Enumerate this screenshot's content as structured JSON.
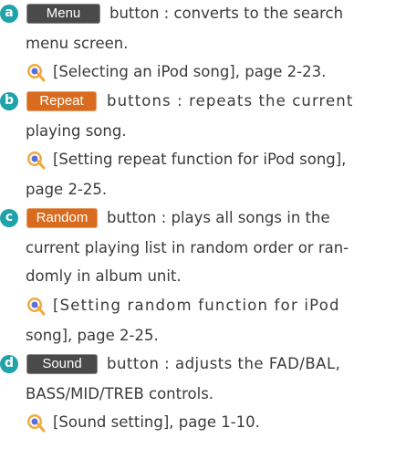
{
  "items": [
    {
      "bullet": "a",
      "button_label": "Menu",
      "desc_first": "button : converts to the search",
      "desc_rest": [
        "menu screen."
      ],
      "ref": [
        "[Selecting an iPod song], page 2-23."
      ]
    },
    {
      "bullet": "b",
      "button_label": "Repeat",
      "desc_first": "buttons : repeats the current",
      "desc_rest": [
        "playing song."
      ],
      "ref": [
        "[Setting repeat function for iPod song],",
        "page 2-25."
      ]
    },
    {
      "bullet": "c",
      "button_label": "Random",
      "desc_first": "button : plays all songs in the",
      "desc_rest": [
        "current playing list in random order or ran-",
        "domly in album unit."
      ],
      "ref": [
        "[Setting random function for iPod",
        "song], page 2-25."
      ]
    },
    {
      "bullet": "d",
      "button_label": "Sound",
      "desc_first": "button : adjusts the FAD/BAL,",
      "desc_rest": [
        "BASS/MID/TREB controls."
      ],
      "ref": [
        "[Sound setting], page 1-10."
      ]
    }
  ],
  "colors": {
    "bullet": "#1fa2a9",
    "menu_button": "#4a4a4a",
    "repeat_button": "#d96b1e",
    "random_button": "#d96b1e",
    "sound_button": "#4a4a4a",
    "text": "#3a3a3a",
    "ref_icon": "#f2a93b"
  },
  "icons": {
    "reference": "magnifier-reference-icon"
  }
}
